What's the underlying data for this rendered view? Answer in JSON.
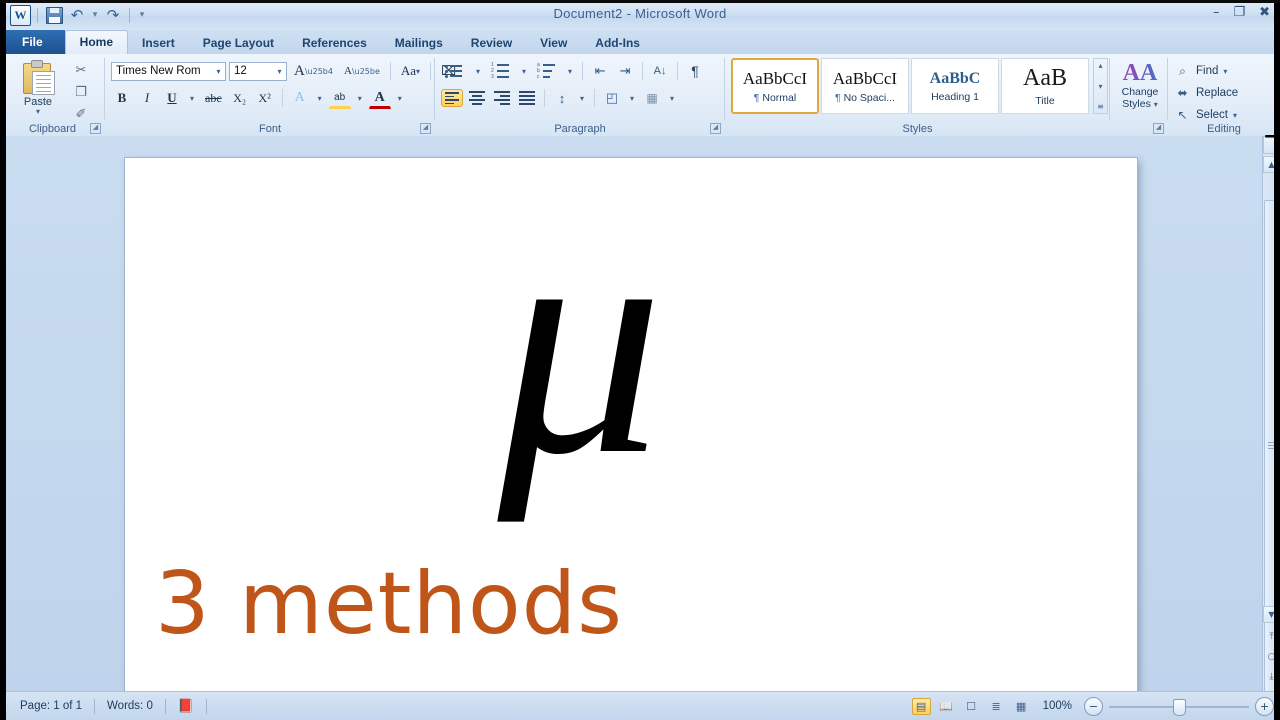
{
  "window": {
    "title": "Document2  -  Microsoft Word",
    "minimize": "–",
    "restore": "❐",
    "close": "✖",
    "collapse_ribbon": "⌃",
    "help": "?"
  },
  "quick_access": {
    "logo": "W",
    "save": "save-icon",
    "undo": "↶",
    "undo_caret": "▾",
    "redo": "↷",
    "customize_caret": "▾"
  },
  "tabs": [
    {
      "label": "File",
      "active": false,
      "kind": "file"
    },
    {
      "label": "Home",
      "active": true,
      "kind": "normal"
    },
    {
      "label": "Insert",
      "active": false,
      "kind": "normal"
    },
    {
      "label": "Page Layout",
      "active": false,
      "kind": "normal"
    },
    {
      "label": "References",
      "active": false,
      "kind": "normal"
    },
    {
      "label": "Mailings",
      "active": false,
      "kind": "normal"
    },
    {
      "label": "Review",
      "active": false,
      "kind": "normal"
    },
    {
      "label": "View",
      "active": false,
      "kind": "normal"
    },
    {
      "label": "Add-Ins",
      "active": false,
      "kind": "normal"
    }
  ],
  "ribbon": {
    "clipboard": {
      "group_label": "Clipboard",
      "paste_label": "Paste",
      "paste_caret": "▾",
      "cut": "✂",
      "copy": "❐",
      "format_painter": "✐",
      "dialog_launcher": "◢"
    },
    "font": {
      "group_label": "Font",
      "font_name": "Times New Rom",
      "font_size": "12",
      "drop_caret": "▾",
      "grow_font": "A",
      "shrink_font": "A",
      "change_case": "Aa",
      "clear_formatting": "⌧",
      "bold": "B",
      "italic": "I",
      "underline": "U",
      "strikethrough": "abc",
      "subscript": "X₂",
      "superscript": "X²",
      "text_effects": "A",
      "highlight": "ab",
      "font_color": "A",
      "dialog_launcher": "◢"
    },
    "paragraph": {
      "group_label": "Paragraph",
      "bullets": "bullets-icon",
      "numbering": "numbering-icon",
      "multilevel": "multilevel-list-icon",
      "decrease_indent": "⇤",
      "increase_indent": "⇥",
      "sort": "↓",
      "sort_az": "A\nZ",
      "show_marks": "¶",
      "align_left": "align-left-icon",
      "align_center": "align-center-icon",
      "align_right": "align-right-icon",
      "justify": "justify-icon",
      "line_spacing": "↕",
      "shading": "◰",
      "borders": "▦",
      "active_alignment": "align_left",
      "dialog_launcher": "◢"
    },
    "styles": {
      "group_label": "Styles",
      "items": [
        {
          "preview": "AaBbCcI",
          "name": "Normal",
          "pilcrow": "¶",
          "selected": true,
          "kind": "normal"
        },
        {
          "preview": "AaBbCcI",
          "name": "No Spaci...",
          "pilcrow": "¶",
          "selected": false,
          "kind": "normal"
        },
        {
          "preview": "AaBbC",
          "name": "Heading 1",
          "pilcrow": "",
          "selected": false,
          "kind": "h1"
        },
        {
          "preview": "AaB",
          "name": "Title",
          "pilcrow": "",
          "selected": false,
          "kind": "title"
        }
      ],
      "nav_up": "▴",
      "nav_down": "▾",
      "nav_more": "≡",
      "dialog_launcher": "◢"
    },
    "change_styles": {
      "icon": "AA",
      "line1": "Change",
      "line2": "Styles",
      "caret": "▾"
    },
    "editing": {
      "group_label": "Editing",
      "items": [
        {
          "icon": "⌕",
          "label": "Find",
          "caret": "▾"
        },
        {
          "icon": "⬌",
          "label": "Replace",
          "caret": ""
        },
        {
          "icon": "↖",
          "label": "Select",
          "caret": "▾"
        }
      ]
    }
  },
  "document": {
    "mu_character": "μ",
    "caption": "3 methods",
    "caption_color": "#c0551a"
  },
  "scrollbar": {
    "split": "▔",
    "up": "▲",
    "down": "▼",
    "prev_page": "⤒",
    "browse_object": "○",
    "next_page": "⤓"
  },
  "status_bar": {
    "page": "Page: 1 of 1",
    "words": "Words: 0",
    "proofing": "proofing-icon",
    "views": [
      {
        "name": "print-layout",
        "glyph": "▤",
        "selected": true
      },
      {
        "name": "full-screen-reading",
        "glyph": "Ὅ6",
        "selected": false
      },
      {
        "name": "web-layout",
        "glyph": "❐",
        "selected": false
      },
      {
        "name": "outline",
        "glyph": "≣",
        "selected": false
      },
      {
        "name": "draft",
        "glyph": "▤",
        "selected": false
      }
    ],
    "zoom_level": "100%",
    "zoom_out": "−",
    "zoom_in": "+"
  }
}
